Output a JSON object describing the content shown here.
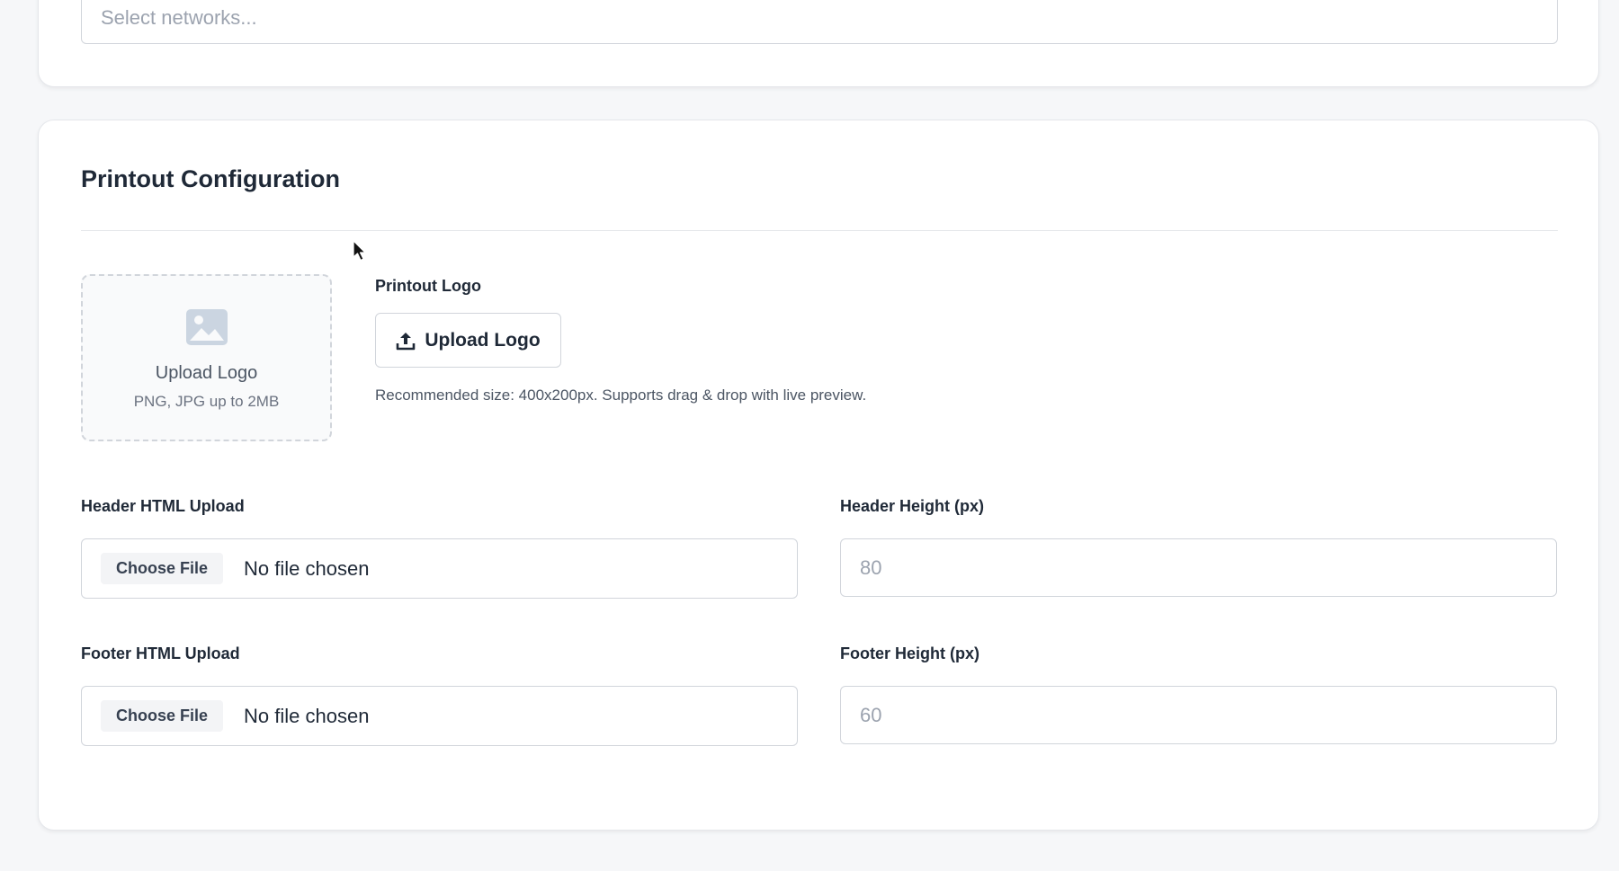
{
  "networks": {
    "placeholder": "Select networks..."
  },
  "printout": {
    "title": "Printout Configuration",
    "dropzone": {
      "title": "Upload Logo",
      "subtitle": "PNG, JPG up to 2MB"
    },
    "logo": {
      "label": "Printout Logo",
      "button_label": "Upload Logo",
      "help": "Recommended size: 400x200px. Supports drag & drop with live preview."
    },
    "header_html": {
      "label": "Header HTML Upload",
      "button_label": "Choose File",
      "status": "No file chosen"
    },
    "header_height": {
      "label": "Header Height (px)",
      "placeholder": "80"
    },
    "footer_html": {
      "label": "Footer HTML Upload",
      "button_label": "Choose File",
      "status": "No file chosen"
    },
    "footer_height": {
      "label": "Footer Height (px)",
      "placeholder": "60"
    }
  },
  "icons": {
    "dropzone": "image-icon",
    "upload": "upload-icon",
    "pointer": "mouse-cursor-icon"
  },
  "colors": {
    "page_bg": "#f6f7f9",
    "card_bg": "#ffffff",
    "border": "#d1d5db",
    "text": "#1f2937",
    "muted": "#6b7280",
    "placeholder": "#9ca3af",
    "icon": "#cbd5e1"
  }
}
